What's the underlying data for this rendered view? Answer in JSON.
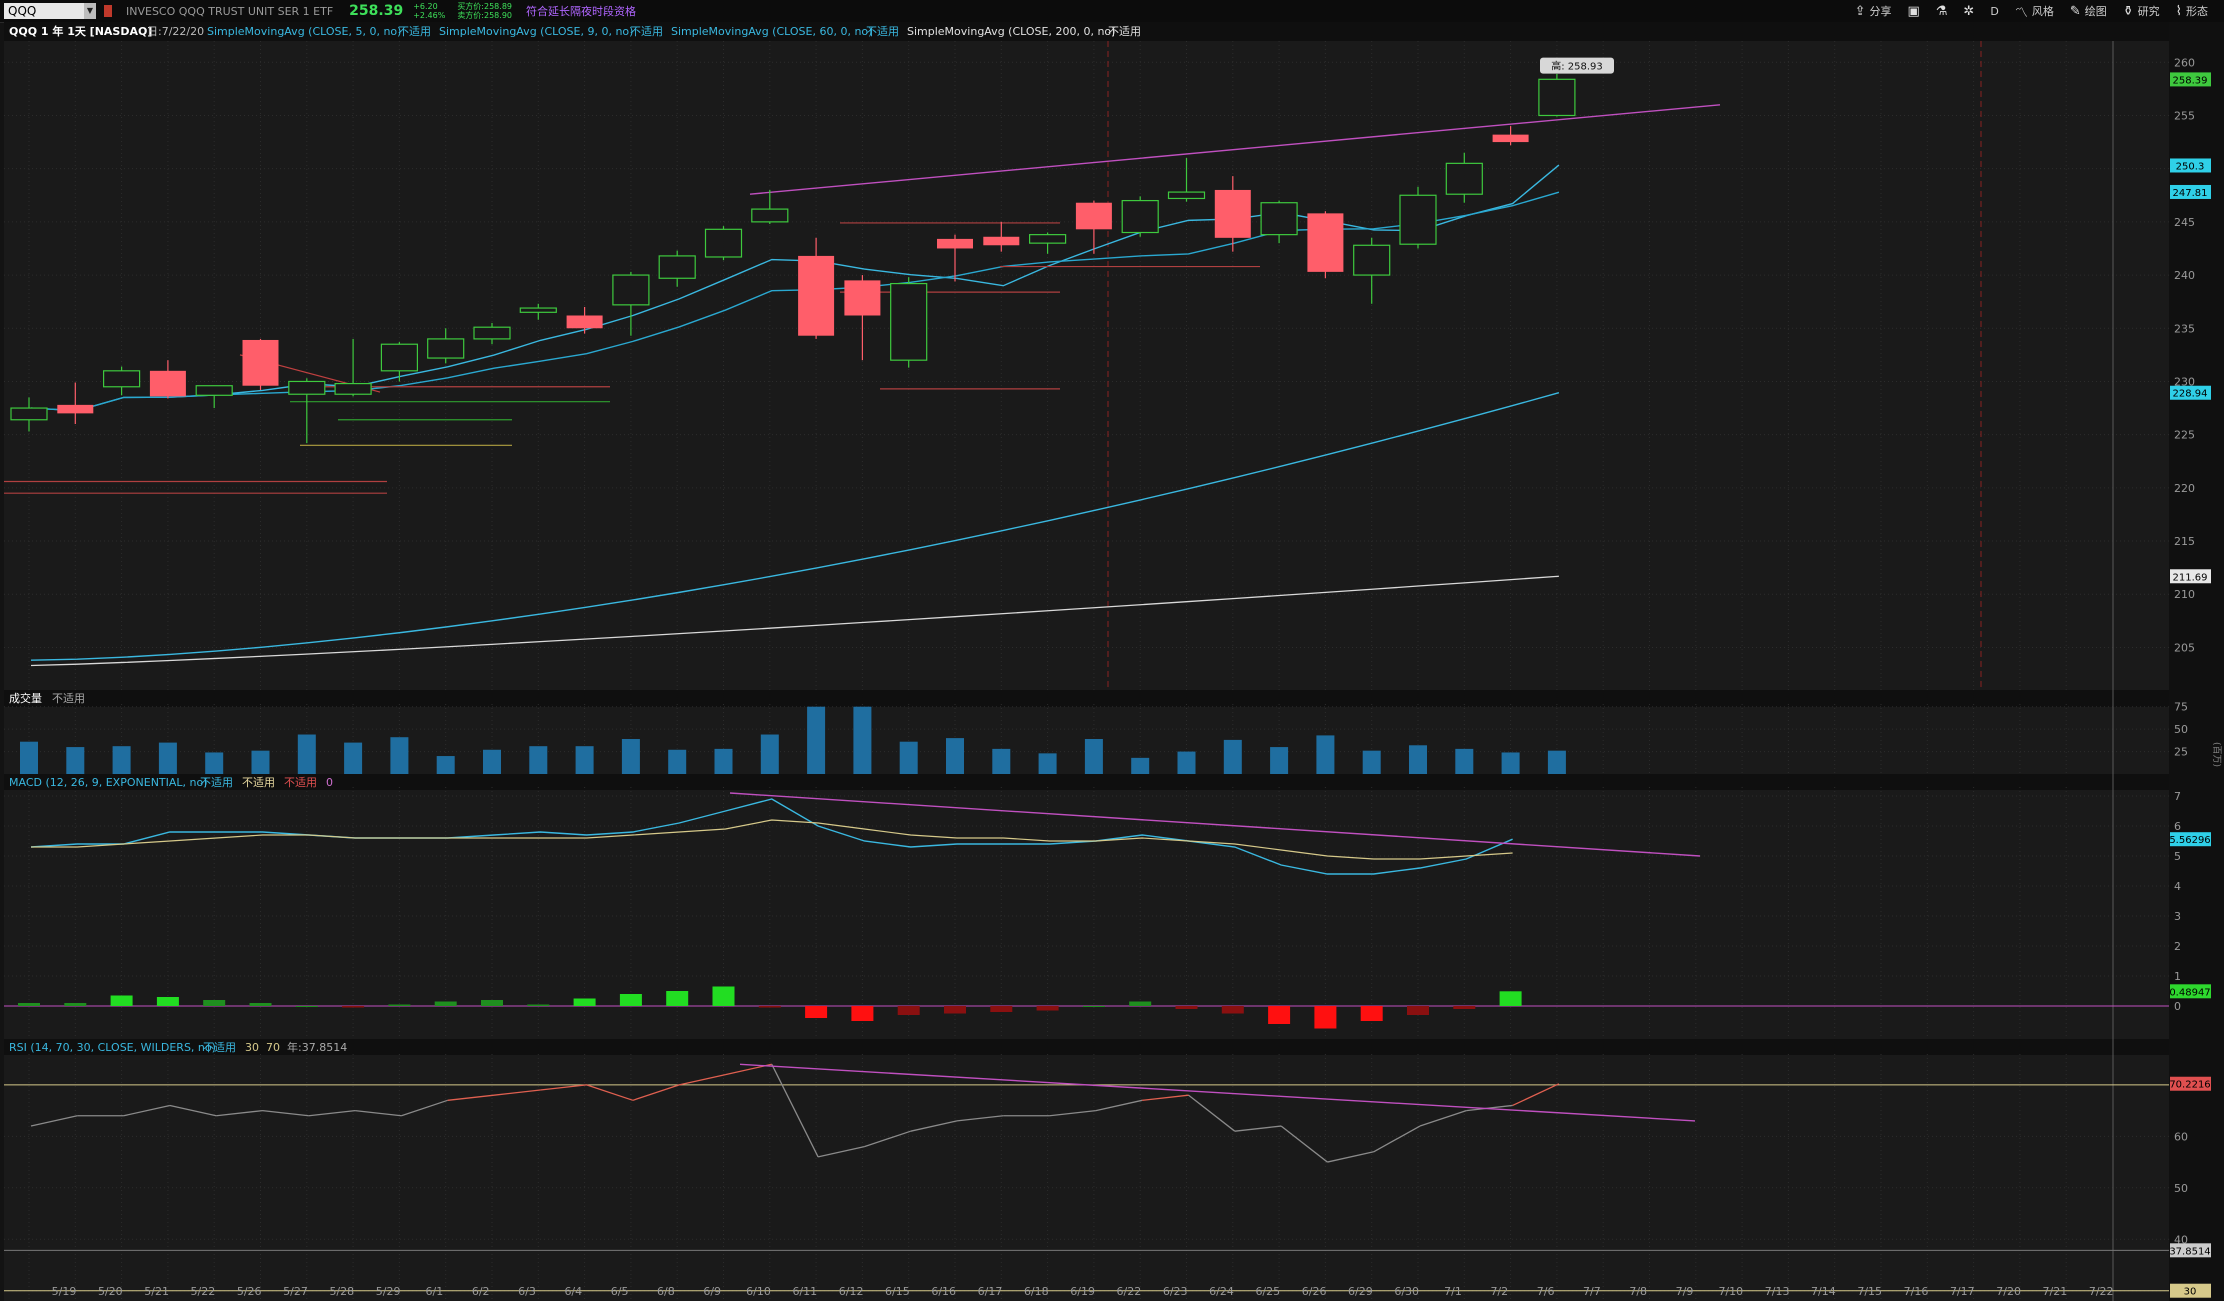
{
  "header": {
    "symbol": "QQQ",
    "description": "INVESCO QQQ TRUST UNIT SER 1 ETF",
    "last_price": "258.39",
    "change": "+6.20",
    "change_pct": "+2.46%",
    "bid": "买方价:258.89",
    "ask": "卖方价:258.90",
    "extended_hours": "符合延长隔夜时段资格"
  },
  "toolbar": {
    "share": "分享",
    "period": "D",
    "style": "风格",
    "drawing": "绘图",
    "studies": "研究",
    "patterns": "形态"
  },
  "chart_data": [
    {
      "type": "candlestick",
      "panel": "price",
      "title_line": "QQQ 1 年 1天 [NASDAQ]",
      "date_label": "日:7/22/20",
      "indicators": [
        {
          "name": "SimpleMovingAvg (CLOSE, 5, 0, no)",
          "value": "不适用",
          "color": "#3ab8e0"
        },
        {
          "name": "SimpleMovingAvg (CLOSE, 9, 0, no)",
          "value": "不适用",
          "color": "#3ab8e0"
        },
        {
          "name": "SimpleMovingAvg (CLOSE, 60, 0, no)",
          "value": "不适用",
          "color": "#3ab8e0"
        },
        {
          "name": "SimpleMovingAvg (CLOSE, 200, 0, no)",
          "value": "不适用",
          "color": "#e0e0e0"
        }
      ],
      "ylim": [
        201,
        262
      ],
      "yticks": [
        205,
        210,
        215,
        220,
        225,
        230,
        235,
        240,
        245,
        250,
        255,
        260
      ],
      "x_labels": [
        "5/19",
        "5/20",
        "5/21",
        "5/22",
        "5/26",
        "5/27",
        "5/28",
        "5/29",
        "6/1",
        "6/2",
        "6/3",
        "6/4",
        "6/5",
        "6/8",
        "6/9",
        "6/10",
        "6/11",
        "6/12",
        "6/15",
        "6/16",
        "6/17",
        "6/18",
        "6/19",
        "6/22",
        "6/23",
        "6/24",
        "6/25",
        "6/26",
        "6/29",
        "6/30",
        "7/1",
        "7/2",
        "7/6",
        "7/7",
        "7/8",
        "7/9",
        "7/10",
        "7/13",
        "7/14",
        "7/15",
        "7/16",
        "7/17",
        "7/20",
        "7/21",
        "7/22"
      ],
      "candles": [
        {
          "date": "5/19",
          "open": 226.4,
          "high": 228.5,
          "low": 225.3,
          "close": 227.5
        },
        {
          "date": "5/20",
          "open": 227.8,
          "high": 229.9,
          "low": 226.0,
          "close": 227.0
        },
        {
          "date": "5/21",
          "open": 229.5,
          "high": 231.4,
          "low": 228.7,
          "close": 231.0
        },
        {
          "date": "5/22",
          "open": 231.0,
          "high": 232.0,
          "low": 228.4,
          "close": 228.6
        },
        {
          "date": "5/26",
          "open": 228.7,
          "high": 229.5,
          "low": 227.5,
          "close": 229.6
        },
        {
          "date": "5/27",
          "open": 233.9,
          "high": 234.0,
          "low": 229.2,
          "close": 229.6
        },
        {
          "date": "5/28",
          "open": 228.8,
          "high": 230.3,
          "low": 224.2,
          "close": 230.0
        },
        {
          "date": "5/29",
          "open": 228.8,
          "high": 234.0,
          "low": 228.6,
          "close": 229.8
        },
        {
          "date": "6/1",
          "open": 231.0,
          "high": 233.7,
          "low": 230.0,
          "close": 233.5
        },
        {
          "date": "6/2",
          "open": 232.2,
          "high": 235.0,
          "low": 231.7,
          "close": 234.0
        },
        {
          "date": "6/3",
          "open": 234.0,
          "high": 235.5,
          "low": 233.5,
          "close": 235.1
        },
        {
          "date": "6/4",
          "open": 236.5,
          "high": 237.3,
          "low": 235.8,
          "close": 236.9
        },
        {
          "date": "6/5",
          "open": 236.2,
          "high": 237.0,
          "low": 234.5,
          "close": 235.0
        },
        {
          "date": "6/8",
          "open": 237.2,
          "high": 240.3,
          "low": 234.3,
          "close": 240.0
        },
        {
          "date": "6/9",
          "open": 239.7,
          "high": 242.3,
          "low": 238.9,
          "close": 241.8
        },
        {
          "date": "6/10",
          "open": 241.7,
          "high": 244.6,
          "low": 241.4,
          "close": 244.3
        },
        {
          "date": "6/11",
          "open": 245.0,
          "high": 248.0,
          "low": 244.8,
          "close": 246.2
        },
        {
          "date": "6/12",
          "open": 241.8,
          "high": 243.5,
          "low": 234.0,
          "close": 234.3
        },
        {
          "date": "6/15",
          "open": 239.5,
          "high": 240.0,
          "low": 232.0,
          "close": 236.2
        },
        {
          "date": "6/16",
          "open": 232.0,
          "high": 239.8,
          "low": 231.3,
          "close": 239.2
        },
        {
          "date": "6/17",
          "open": 243.4,
          "high": 243.8,
          "low": 239.4,
          "close": 242.5
        },
        {
          "date": "6/18",
          "open": 243.6,
          "high": 245.0,
          "low": 242.2,
          "close": 242.8
        },
        {
          "date": "6/19",
          "open": 243.0,
          "high": 244.0,
          "low": 242.0,
          "close": 243.8
        },
        {
          "date": "6/22",
          "open": 246.8,
          "high": 247.0,
          "low": 242.0,
          "close": 244.3
        },
        {
          "date": "6/23",
          "open": 244.0,
          "high": 247.4,
          "low": 243.6,
          "close": 247.0
        },
        {
          "date": "6/24",
          "open": 247.2,
          "high": 251.0,
          "low": 246.9,
          "close": 247.8
        },
        {
          "date": "6/25",
          "open": 248.0,
          "high": 249.3,
          "low": 242.2,
          "close": 243.5
        },
        {
          "date": "6/26",
          "open": 243.8,
          "high": 247.0,
          "low": 243.0,
          "close": 246.8
        },
        {
          "date": "6/29",
          "open": 245.8,
          "high": 246.0,
          "low": 239.7,
          "close": 240.3
        },
        {
          "date": "6/30",
          "open": 240.0,
          "high": 243.5,
          "low": 237.3,
          "close": 242.8
        },
        {
          "date": "7/1",
          "open": 242.9,
          "high": 248.3,
          "low": 242.5,
          "close": 247.5
        },
        {
          "date": "7/2",
          "open": 247.6,
          "high": 251.5,
          "low": 246.8,
          "close": 250.5
        },
        {
          "date": "7/6",
          "open": 253.2,
          "high": 254.0,
          "low": 252.2,
          "close": 252.5
        },
        {
          "date": "7/7",
          "open": 255.0,
          "high": 258.9,
          "low": 254.9,
          "close": 258.4
        }
      ],
      "right_labels": [
        {
          "text": "258.39",
          "value": 258.39,
          "color": "#3ec93e"
        },
        {
          "text": "250.3",
          "value": 250.3,
          "color": "#2fd0e8"
        },
        {
          "text": "247.81",
          "value": 247.81,
          "color": "#2fd0e8"
        },
        {
          "text": "228.94",
          "value": 228.94,
          "color": "#2fd0e8"
        },
        {
          "text": "211.69",
          "value": 211.69,
          "color": "#e8e8e8"
        }
      ],
      "high_callout": {
        "text": "高: 258.93",
        "value": 258.93
      }
    },
    {
      "type": "bar",
      "panel": "volume",
      "label": "成交量",
      "value_label": "不适用",
      "yticks": [
        25,
        50,
        75
      ],
      "axis_unit": "(百万)",
      "values": [
        36,
        30,
        31,
        35,
        24,
        26,
        44,
        35,
        41,
        20,
        27,
        31,
        31,
        39,
        27,
        28,
        44,
        75,
        75,
        36,
        40,
        28,
        23,
        39,
        18,
        25,
        38,
        30,
        43,
        26,
        32,
        28,
        24,
        26
      ]
    },
    {
      "type": "line",
      "panel": "macd",
      "label": "MACD (12, 26, 9, EXPONENTIAL, no)",
      "value_labels": [
        "不适用",
        "不适用",
        "不适用",
        "0"
      ],
      "yticks": [
        0,
        1,
        2,
        3,
        4,
        5,
        6,
        7
      ],
      "ylim": [
        -1.1,
        7.3
      ],
      "macd": [
        5.3,
        5.4,
        5.4,
        5.8,
        5.8,
        5.8,
        5.7,
        5.6,
        5.6,
        5.6,
        5.7,
        5.8,
        5.7,
        5.8,
        6.1,
        6.5,
        6.9,
        6.0,
        5.5,
        5.3,
        5.4,
        5.4,
        5.4,
        5.5,
        5.7,
        5.5,
        5.3,
        4.7,
        4.4,
        4.4,
        4.6,
        4.9,
        5.56
      ],
      "signal": [
        5.3,
        5.3,
        5.4,
        5.5,
        5.6,
        5.7,
        5.7,
        5.6,
        5.6,
        5.6,
        5.6,
        5.6,
        5.6,
        5.7,
        5.8,
        5.9,
        6.2,
        6.1,
        5.9,
        5.7,
        5.6,
        5.6,
        5.5,
        5.5,
        5.6,
        5.5,
        5.4,
        5.2,
        5.0,
        4.9,
        4.9,
        5.0,
        5.1
      ],
      "hist": [
        0.1,
        0.1,
        0.35,
        0.3,
        0.2,
        0.1,
        0.0,
        -0.05,
        0.05,
        0.15,
        0.2,
        0.05,
        0.25,
        0.4,
        0.5,
        0.65,
        -0.05,
        -0.4,
        -0.5,
        -0.3,
        -0.25,
        -0.2,
        -0.15,
        0.0,
        0.15,
        -0.1,
        -0.25,
        -0.6,
        -0.75,
        -0.5,
        -0.3,
        -0.1,
        0.49
      ],
      "right_labels": [
        {
          "text": "5.56296",
          "value": 5.56,
          "color": "#2fd0e8"
        },
        {
          "text": "0.48947",
          "value": 0.49,
          "color": "#2ed82e"
        }
      ]
    },
    {
      "type": "line",
      "panel": "rsi",
      "label": "RSI (14, 70, 30, CLOSE, WILDERS, no)",
      "value_labels": [
        "不适用",
        "30",
        "70",
        "年:37.8514"
      ],
      "yticks": [
        30,
        40,
        50,
        60
      ],
      "ylim": [
        28,
        76
      ],
      "values": [
        62,
        64,
        64,
        66,
        64,
        65,
        64,
        65,
        64,
        67,
        68,
        69,
        70,
        67,
        70,
        72,
        74,
        56,
        58,
        61,
        63,
        64,
        64,
        65,
        67,
        68,
        61,
        62,
        55,
        57,
        62,
        65,
        66,
        70.2
      ],
      "right_labels": [
        {
          "text": "70.2216",
          "value": 70.2216,
          "color": "#e05050"
        },
        {
          "text": "37.8514",
          "value": 37.8514,
          "color": "#cccccc"
        },
        {
          "text": "30",
          "value": 30,
          "color": "#d6c98a"
        }
      ]
    }
  ]
}
